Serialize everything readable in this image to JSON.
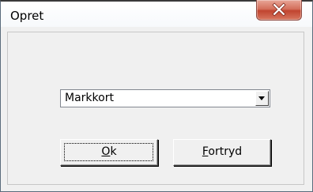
{
  "window": {
    "title": "Opret",
    "close_icon": "close-icon"
  },
  "combo": {
    "selected_value": "Markkort"
  },
  "buttons": {
    "ok": {
      "mnemonic": "O",
      "rest": "k"
    },
    "cancel": {
      "mnemonic": "F",
      "rest": "ortryd"
    }
  },
  "colors": {
    "dialog_background": "#f0f0f0",
    "close_button_red": "#c04530"
  }
}
